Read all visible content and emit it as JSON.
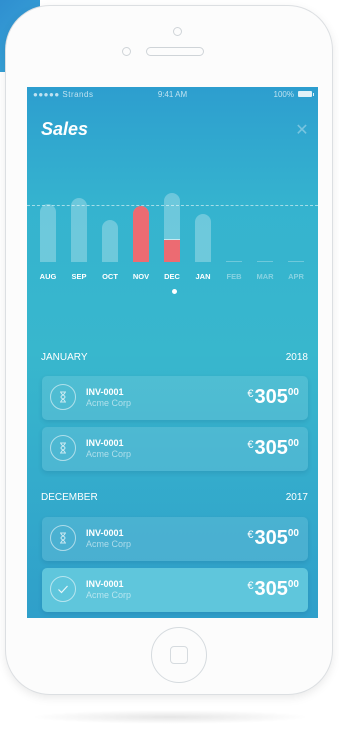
{
  "status": {
    "carrier": "●●●●● Strands",
    "time": "9:41 AM",
    "battery": "100%"
  },
  "header": {
    "title": "Sales",
    "close_icon": "close-icon"
  },
  "chart_data": {
    "type": "bar",
    "categories": [
      "AUG",
      "SEP",
      "OCT",
      "NOV",
      "DEC",
      "JAN",
      "FEB",
      "MAR",
      "APR"
    ],
    "values": [
      73,
      80,
      52,
      70,
      86,
      60,
      0,
      0,
      0
    ],
    "highlighted": [
      null,
      null,
      null,
      70,
      28,
      null,
      null,
      null,
      null
    ],
    "dimmed_categories": [
      "FEB",
      "MAR",
      "APR"
    ],
    "highlight_color": "#ec6b72",
    "ylim": [
      0,
      100
    ],
    "grid": false
  },
  "sections": [
    {
      "month": "JANUARY",
      "year": "2018",
      "invoices": [
        {
          "id": "INV-0001",
          "customer": "Acme Corp",
          "currency": "€",
          "amount": "305",
          "cents": "00",
          "icon": "hourglass-icon",
          "active": false
        },
        {
          "id": "INV-0001",
          "customer": "Acme Corp",
          "currency": "€",
          "amount": "305",
          "cents": "00",
          "icon": "hourglass-icon",
          "active": false
        }
      ]
    },
    {
      "month": "DECEMBER",
      "year": "2017",
      "invoices": [
        {
          "id": "INV-0001",
          "customer": "Acme Corp",
          "currency": "€",
          "amount": "305",
          "cents": "00",
          "icon": "hourglass-icon",
          "active": false
        },
        {
          "id": "INV-0001",
          "customer": "Acme Corp",
          "currency": "€",
          "amount": "305",
          "cents": "00",
          "icon": "checkmark-icon",
          "active": true
        }
      ]
    }
  ]
}
